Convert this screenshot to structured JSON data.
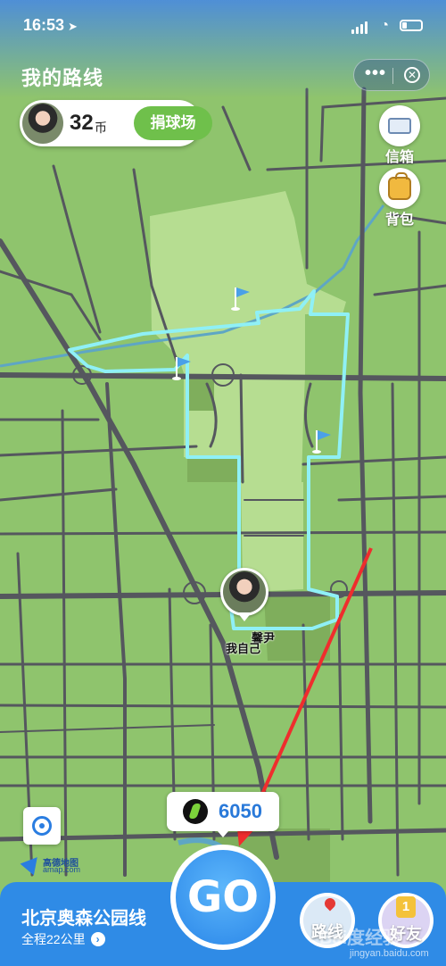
{
  "status_bar": {
    "time": "16:53"
  },
  "header": {
    "title": "我的路线"
  },
  "coins": {
    "count": "32",
    "unit": "币",
    "donate_label": "捐球场"
  },
  "side_buttons": {
    "mailbox_label": "信箱",
    "backpack_label": "背包"
  },
  "map": {
    "self_label": "我自己",
    "friend_label": "馨尹",
    "provider_name": "高德地图",
    "provider_url": "amap.com",
    "colors": {
      "land": "#8fc46d",
      "park": "#b6dd91",
      "road": "#55575e",
      "route": "#8ff0f6"
    }
  },
  "steps": {
    "value": "6050"
  },
  "route": {
    "name": "北京奥森公园线",
    "distance": "全程22公里"
  },
  "actions": {
    "go_label": "GO",
    "route_label": "路线",
    "friends_label": "好友"
  },
  "watermark": {
    "main": "Bai度经验",
    "sub": "jingyan.baidu.com"
  },
  "icons": [
    "location-arrow-icon",
    "signal-icon",
    "wifi-icon",
    "battery-icon",
    "more-dots-icon",
    "close-icon",
    "mailbox-icon",
    "backpack-icon",
    "locate-icon",
    "runner-icon",
    "chevron-right-icon",
    "map-pin-icon",
    "medal-icon",
    "flag-icon"
  ]
}
